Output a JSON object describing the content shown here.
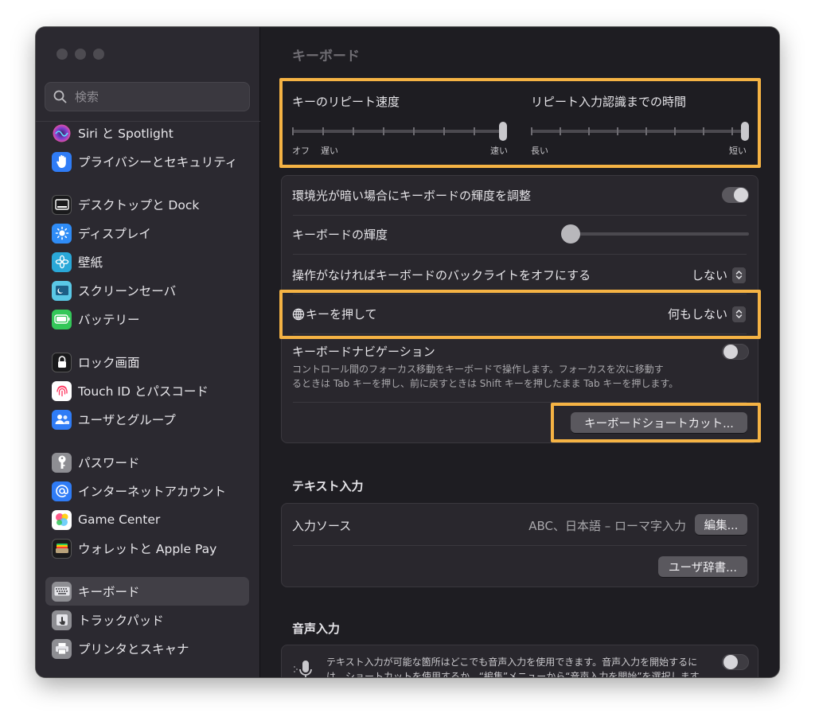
{
  "window": {
    "title": "キーボード"
  },
  "search": {
    "placeholder": "検索"
  },
  "sidebar": {
    "items": [
      {
        "label": "Siri と Spotlight",
        "icon": "siri-icon"
      },
      {
        "label": "プライバシーとセキュリティ",
        "icon": "privacy-hand-icon"
      },
      {
        "label": "デスクトップと Dock",
        "icon": "dock-icon"
      },
      {
        "label": "ディスプレイ",
        "icon": "display-sun-icon"
      },
      {
        "label": "壁紙",
        "icon": "wallpaper-flower-icon"
      },
      {
        "label": "スクリーンセーバ",
        "icon": "screensaver-icon"
      },
      {
        "label": "バッテリー",
        "icon": "battery-icon"
      },
      {
        "label": "ロック画面",
        "icon": "lock-icon"
      },
      {
        "label": "Touch ID とパスコード",
        "icon": "fingerprint-icon"
      },
      {
        "label": "ユーザとグループ",
        "icon": "users-icon"
      },
      {
        "label": "パスワード",
        "icon": "key-icon"
      },
      {
        "label": "インターネットアカウント",
        "icon": "at-icon"
      },
      {
        "label": "Game Center",
        "icon": "game-center-icon"
      },
      {
        "label": "ウォレットと Apple Pay",
        "icon": "wallet-icon"
      },
      {
        "label": "キーボード",
        "icon": "keyboard-icon",
        "selected": true
      },
      {
        "label": "トラックパッド",
        "icon": "trackpad-icon"
      },
      {
        "label": "プリンタとスキャナ",
        "icon": "printer-icon"
      }
    ]
  },
  "repeat": {
    "key_repeat_label": "キーのリピート速度",
    "key_repeat_min_off": "オフ",
    "key_repeat_min": "遅い",
    "key_repeat_max": "速い",
    "key_repeat_level": 1.0,
    "delay_label": "リピート入力認識までの時間",
    "delay_min": "長い",
    "delay_max": "短い",
    "delay_level": 1.0
  },
  "settings": {
    "ambient_label": "環境光が暗い場合にキーボードの輝度を調整",
    "ambient_on": true,
    "brightness_label": "キーボードの輝度",
    "brightness_level": 0.0,
    "backlight_off_label": "操作がなければキーボードのバックライトをオフにする",
    "backlight_off_value": "しない",
    "globe_label": "キーを押して",
    "globe_value": "何もしない",
    "nav_label": "キーボードナビゲーション",
    "nav_desc_line1": "コントロール間のフォーカス移動をキーボードで操作します。フォーカスを次に移動す",
    "nav_desc_line2": "るときは Tab キーを押し、前に戻すときは Shift キーを押したまま Tab キーを押します。",
    "nav_on": false,
    "shortcuts_button": "キーボードショートカット..."
  },
  "text_input": {
    "section_title": "テキスト入力",
    "sources_label": "入力ソース",
    "sources_value": "ABC、日本語 – ローマ字入力",
    "edit_button": "編集...",
    "dictionary_button": "ユーザ辞書..."
  },
  "dictation": {
    "section_title": "音声入力",
    "desc_line1": "テキスト入力が可能な箇所はどこでも音声入力を使用できます。音声入力を開始するに",
    "desc_line2": "は、ショートカットを使用するか、“編集”メニューから“音声入力を開始”を選択します。",
    "on": false
  },
  "colors": {
    "highlight": "#f5b344",
    "selected_bg": "#413f46"
  }
}
